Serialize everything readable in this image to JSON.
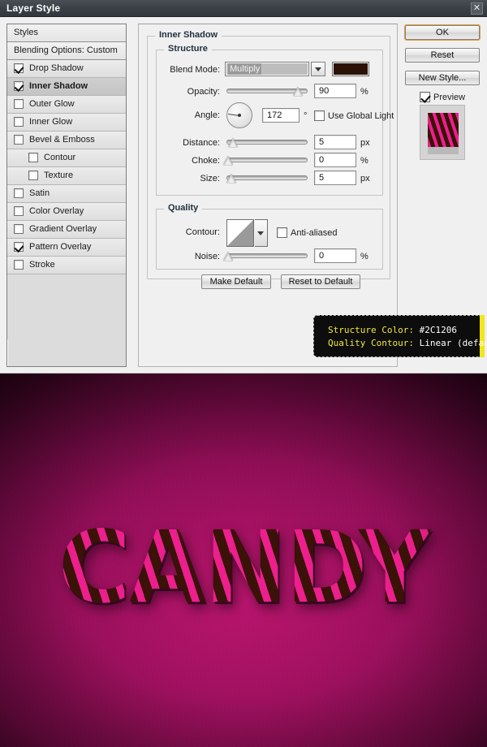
{
  "window": {
    "title": "Layer Style",
    "close_label": "✕"
  },
  "styles_panel": {
    "header": "Styles",
    "blending_options": "Blending Options: Custom",
    "items": [
      {
        "label": "Drop Shadow",
        "checked": true,
        "indent": false,
        "selected": false
      },
      {
        "label": "Inner Shadow",
        "checked": true,
        "indent": false,
        "selected": true
      },
      {
        "label": "Outer Glow",
        "checked": false,
        "indent": false,
        "selected": false
      },
      {
        "label": "Inner Glow",
        "checked": false,
        "indent": false,
        "selected": false
      },
      {
        "label": "Bevel & Emboss",
        "checked": false,
        "indent": false,
        "selected": false
      },
      {
        "label": "Contour",
        "checked": false,
        "indent": true,
        "selected": false
      },
      {
        "label": "Texture",
        "checked": false,
        "indent": true,
        "selected": false
      },
      {
        "label": "Satin",
        "checked": false,
        "indent": false,
        "selected": false
      },
      {
        "label": "Color Overlay",
        "checked": false,
        "indent": false,
        "selected": false
      },
      {
        "label": "Gradient Overlay",
        "checked": false,
        "indent": false,
        "selected": false
      },
      {
        "label": "Pattern Overlay",
        "checked": true,
        "indent": false,
        "selected": false
      },
      {
        "label": "Stroke",
        "checked": false,
        "indent": false,
        "selected": false
      }
    ]
  },
  "main": {
    "group_title": "Inner Shadow",
    "structure": {
      "title": "Structure",
      "blend_mode_label": "Blend Mode:",
      "blend_mode_value": "Multiply",
      "color_swatch": "#2C1206",
      "opacity_label": "Opacity:",
      "opacity_value": "90",
      "opacity_unit": "%",
      "angle_label": "Angle:",
      "angle_value": "172",
      "angle_unit": "°",
      "use_global_light_label": "Use Global Light",
      "use_global_light_checked": false,
      "distance_label": "Distance:",
      "distance_value": "5",
      "distance_unit": "px",
      "choke_label": "Choke:",
      "choke_value": "0",
      "choke_unit": "%",
      "size_label": "Size:",
      "size_value": "5",
      "size_unit": "px"
    },
    "quality": {
      "title": "Quality",
      "contour_label": "Contour:",
      "contour_value": "Linear",
      "anti_aliased_label": "Anti-aliased",
      "anti_aliased_checked": false,
      "noise_label": "Noise:",
      "noise_value": "0",
      "noise_unit": "%"
    },
    "make_default_label": "Make Default",
    "reset_to_default_label": "Reset to Default"
  },
  "right_column": {
    "ok_label": "OK",
    "reset_label": "Reset",
    "new_style_label": "New Style...",
    "preview_label": "Preview",
    "preview_checked": true
  },
  "tooltip": {
    "line1_key": "Structure Color:",
    "line1_value": "#2C1206",
    "line2_key": "Quality Contour:",
    "line2_value": "Linear (default)",
    "accent_color": "#F2E61C",
    "text_color": "#F4E83B"
  },
  "canvas": {
    "text": "CANDY",
    "background_color": "#A81266",
    "stripe_color_a": "#EC1F8D",
    "stripe_color_b": "#3A1208"
  }
}
